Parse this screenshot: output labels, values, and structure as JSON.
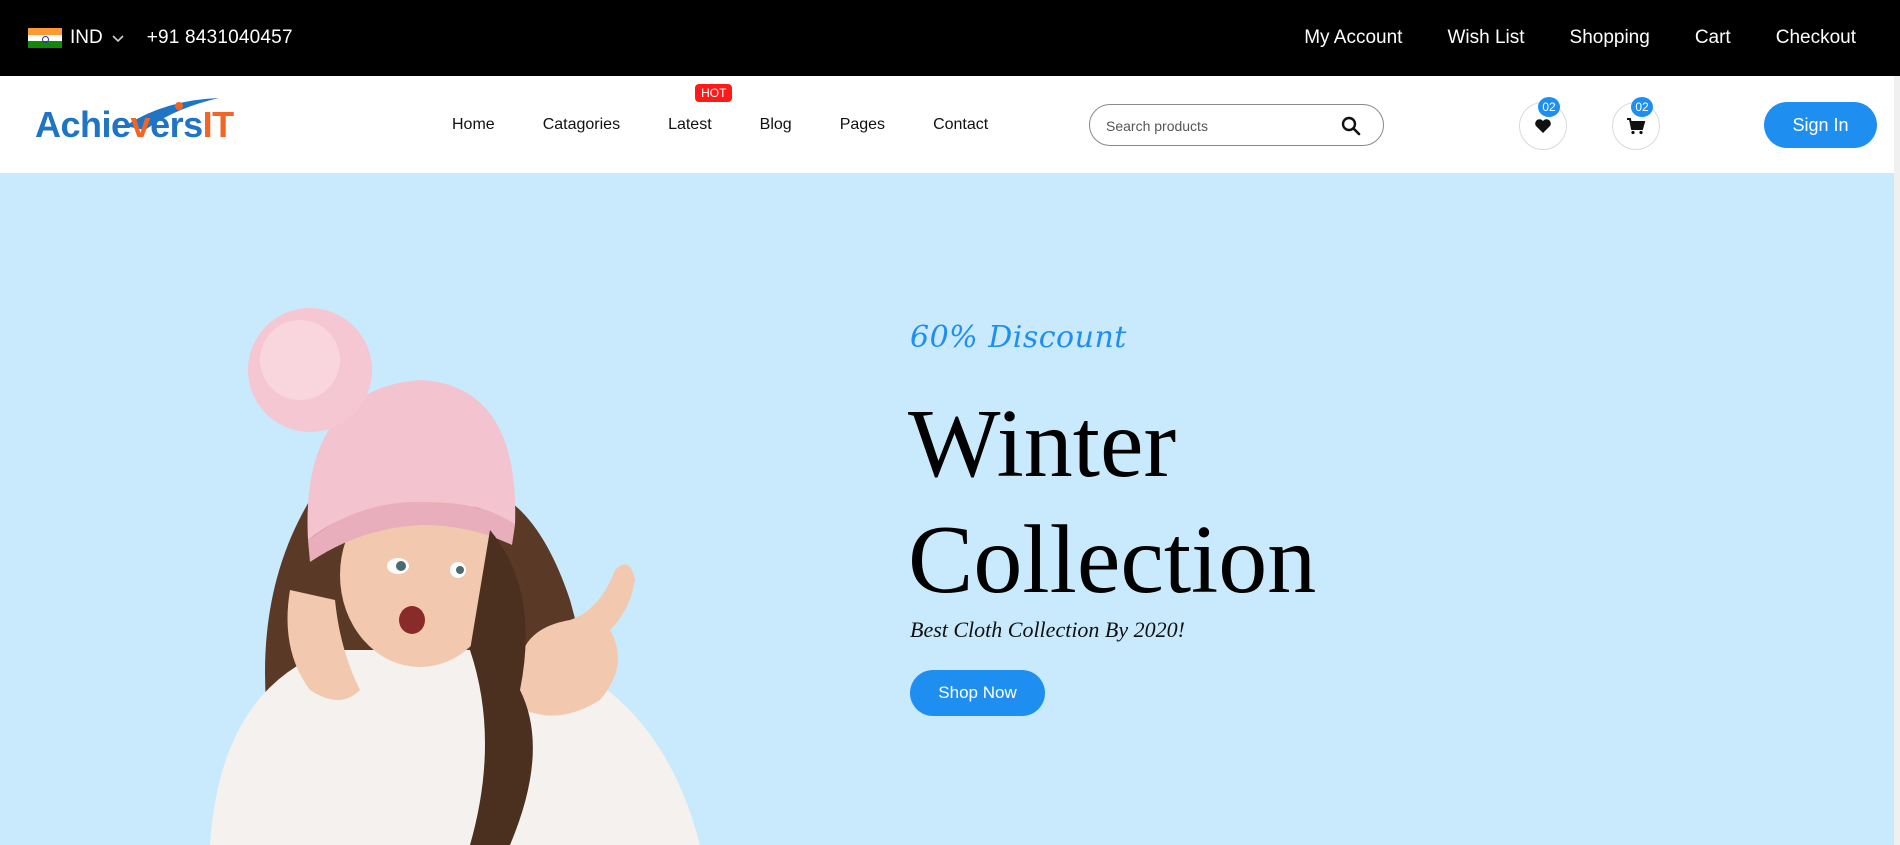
{
  "topbar": {
    "country": "IND",
    "phone": "+91 8431040457",
    "links": [
      "My Account",
      "Wish List",
      "Shopping",
      "Cart",
      "Checkout"
    ]
  },
  "header": {
    "logo": {
      "part1": "Achie",
      "part2": "v",
      "part3": "ers",
      "part4": "IT"
    },
    "nav": [
      "Home",
      "Catagories",
      "Latest",
      "Blog",
      "Pages",
      "Contact"
    ],
    "hot_badge": "HOT",
    "search": {
      "placeholder": "Search products",
      "value": ""
    },
    "wishlist_count": "02",
    "cart_count": "02",
    "signin_label": "Sign In"
  },
  "hero": {
    "discount": "60% Discount",
    "title_line1": "Winter",
    "title_line2": "Collection",
    "subtitle": "Best Cloth Collection By 2020!",
    "cta": "Shop Now"
  },
  "colors": {
    "accent": "#1e8ff0",
    "hero_bg": "#c8eafc",
    "topbar_bg": "#000000",
    "hot": "#ff1a1a",
    "logo_blue": "#1f74c4",
    "logo_orange": "#f26522"
  },
  "icons": [
    "india-flag-icon",
    "chevron-down-icon",
    "search-icon",
    "heart-icon",
    "cart-icon"
  ]
}
